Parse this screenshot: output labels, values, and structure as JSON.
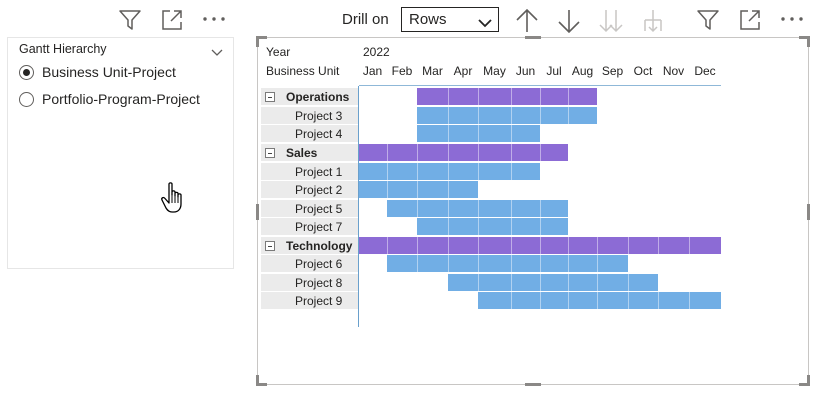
{
  "left_visual": {
    "header_icons": [
      {
        "name": "filter-icon"
      },
      {
        "name": "focus-mode-icon"
      },
      {
        "name": "more-options-icon"
      }
    ]
  },
  "slicer": {
    "title": "Gantt Hierarchy",
    "options": [
      {
        "label": "Business Unit-Project",
        "selected": true
      },
      {
        "label": "Portfolio-Program-Project",
        "selected": false
      }
    ]
  },
  "toolbar": {
    "drill_label": "Drill on",
    "drill_value": "Rows",
    "drill_options": [
      "Rows"
    ],
    "icons": [
      {
        "name": "drill-up-icon",
        "enabled": true
      },
      {
        "name": "drill-down-icon",
        "enabled": true
      },
      {
        "name": "expand-next-level-icon",
        "enabled": false
      },
      {
        "name": "expand-hierarchy-icon",
        "enabled": false
      },
      {
        "name": "filter-icon",
        "enabled": true
      },
      {
        "name": "focus-mode-icon",
        "enabled": true
      },
      {
        "name": "more-options-icon",
        "enabled": true
      }
    ]
  },
  "gantt": {
    "year_label": "Year",
    "year_value": "2022",
    "bu_label": "Business Unit",
    "months": [
      "Jan",
      "Feb",
      "Mar",
      "Apr",
      "May",
      "Jun",
      "Jul",
      "Aug",
      "Sep",
      "Oct",
      "Nov",
      "Dec"
    ],
    "colors": {
      "group": "#8c6bd5",
      "project": "#71aee5"
    },
    "rows": [
      {
        "label": "Operations",
        "group": true,
        "start": 3,
        "end": 8
      },
      {
        "label": "Project 3",
        "group": false,
        "start": 3,
        "end": 8
      },
      {
        "label": "Project 4",
        "group": false,
        "start": 3,
        "end": 6
      },
      {
        "label": "Sales",
        "group": true,
        "start": 1,
        "end": 7
      },
      {
        "label": "Project 1",
        "group": false,
        "start": 1,
        "end": 6
      },
      {
        "label": "Project 2",
        "group": false,
        "start": 1,
        "end": 4
      },
      {
        "label": "Project 5",
        "group": false,
        "start": 2,
        "end": 7
      },
      {
        "label": "Project 7",
        "group": false,
        "start": 3,
        "end": 7
      },
      {
        "label": "Technology",
        "group": true,
        "start": 1,
        "end": 12
      },
      {
        "label": "Project 6",
        "group": false,
        "start": 2,
        "end": 9
      },
      {
        "label": "Project 8",
        "group": false,
        "start": 4,
        "end": 10
      },
      {
        "label": "Project 9",
        "group": false,
        "start": 5,
        "end": 12
      }
    ]
  }
}
